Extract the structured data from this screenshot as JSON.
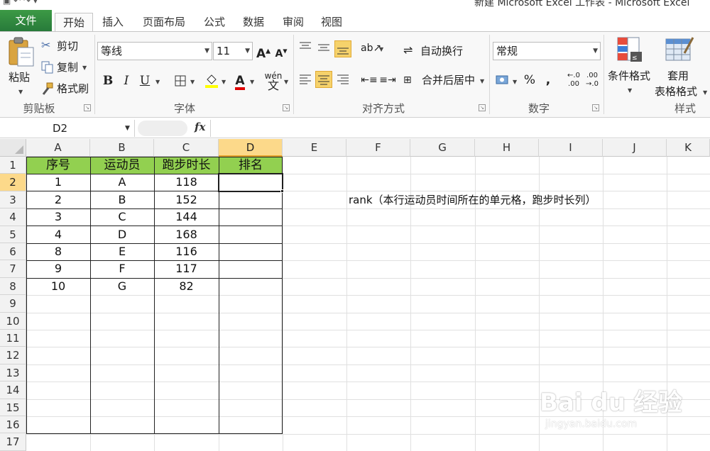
{
  "window": {
    "title": "新建 Microsoft Excel 工作表 - Microsoft Excel"
  },
  "tabs": [
    "文件",
    "开始",
    "插入",
    "页面布局",
    "公式",
    "数据",
    "审阅",
    "视图"
  ],
  "active_tab": "开始",
  "ribbon": {
    "clipboard": {
      "paste": "粘贴",
      "cut": "剪切",
      "copy": "复制",
      "format_painter": "格式刷",
      "label": "剪贴板"
    },
    "font": {
      "name": "等线",
      "size": "11",
      "bold": "B",
      "italic": "I",
      "underline": "U",
      "label": "字体"
    },
    "alignment": {
      "wrap_text": "自动换行",
      "merge_center": "合并后居中",
      "label": "对齐方式"
    },
    "number": {
      "format": "常规",
      "percent": "%",
      "comma": ",",
      "label": "数字"
    },
    "styles": {
      "conditional_format": "条件格式",
      "table_format": "套用",
      "table_format_2": "表格格式",
      "label": "样式"
    }
  },
  "formula_bar": {
    "name_box": "D2",
    "fx": "fx",
    "formula": ""
  },
  "sheet": {
    "columns": [
      "A",
      "B",
      "C",
      "D",
      "E",
      "F",
      "G",
      "H",
      "I",
      "J",
      "K"
    ],
    "rows": [
      "1",
      "2",
      "3",
      "4",
      "5",
      "6",
      "7",
      "8",
      "9",
      "10",
      "11",
      "12",
      "13",
      "14",
      "15",
      "16",
      "17"
    ],
    "selected_cell": "D2",
    "headers": [
      "序号",
      "运动员",
      "跑步时长",
      "排名"
    ],
    "data": [
      [
        "1",
        "A",
        "118",
        ""
      ],
      [
        "2",
        "B",
        "152",
        ""
      ],
      [
        "3",
        "C",
        "144",
        ""
      ],
      [
        "4",
        "D",
        "168",
        ""
      ],
      [
        "8",
        "E",
        "116",
        ""
      ],
      [
        "9",
        "F",
        "117",
        ""
      ],
      [
        "10",
        "G",
        "82",
        ""
      ]
    ],
    "note": "rank（本行运动员时间所在的单元格，跑步时长列）"
  },
  "watermark": {
    "brand": "Bai du 经验",
    "url": "jingyan.baidu.com"
  },
  "colors": {
    "file_tab": "#2e8b3a",
    "header_fill": "#92d050",
    "selection_highlight": "#fcd98a"
  }
}
